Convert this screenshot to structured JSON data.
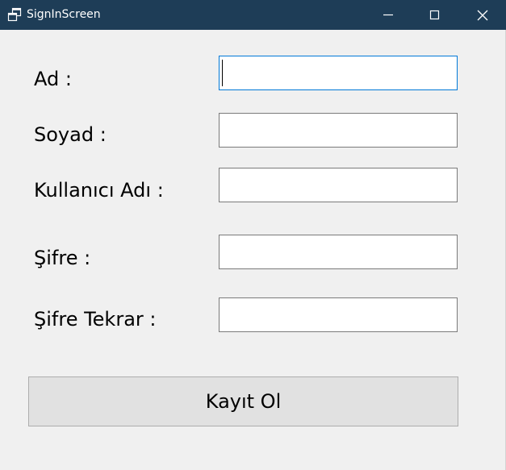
{
  "window": {
    "title": "SignInScreen",
    "icon": "app-window-icon",
    "controls": {
      "minimize_icon": "minimize-icon",
      "maximize_icon": "maximize-icon",
      "close_icon": "close-icon"
    },
    "colors": {
      "titlebar": "#1e3d57",
      "background": "#f0f0f0",
      "focus_border": "#0078d7"
    }
  },
  "form": {
    "fields": [
      {
        "label": "Ad :",
        "value": "",
        "focused": true
      },
      {
        "label": "Soyad :",
        "value": ""
      },
      {
        "label": "Kullanıcı Adı :",
        "value": ""
      },
      {
        "label": "Şifre :",
        "value": ""
      },
      {
        "label": "Şifre Tekrar :",
        "value": ""
      }
    ],
    "submit_label": "Kayıt Ol"
  }
}
